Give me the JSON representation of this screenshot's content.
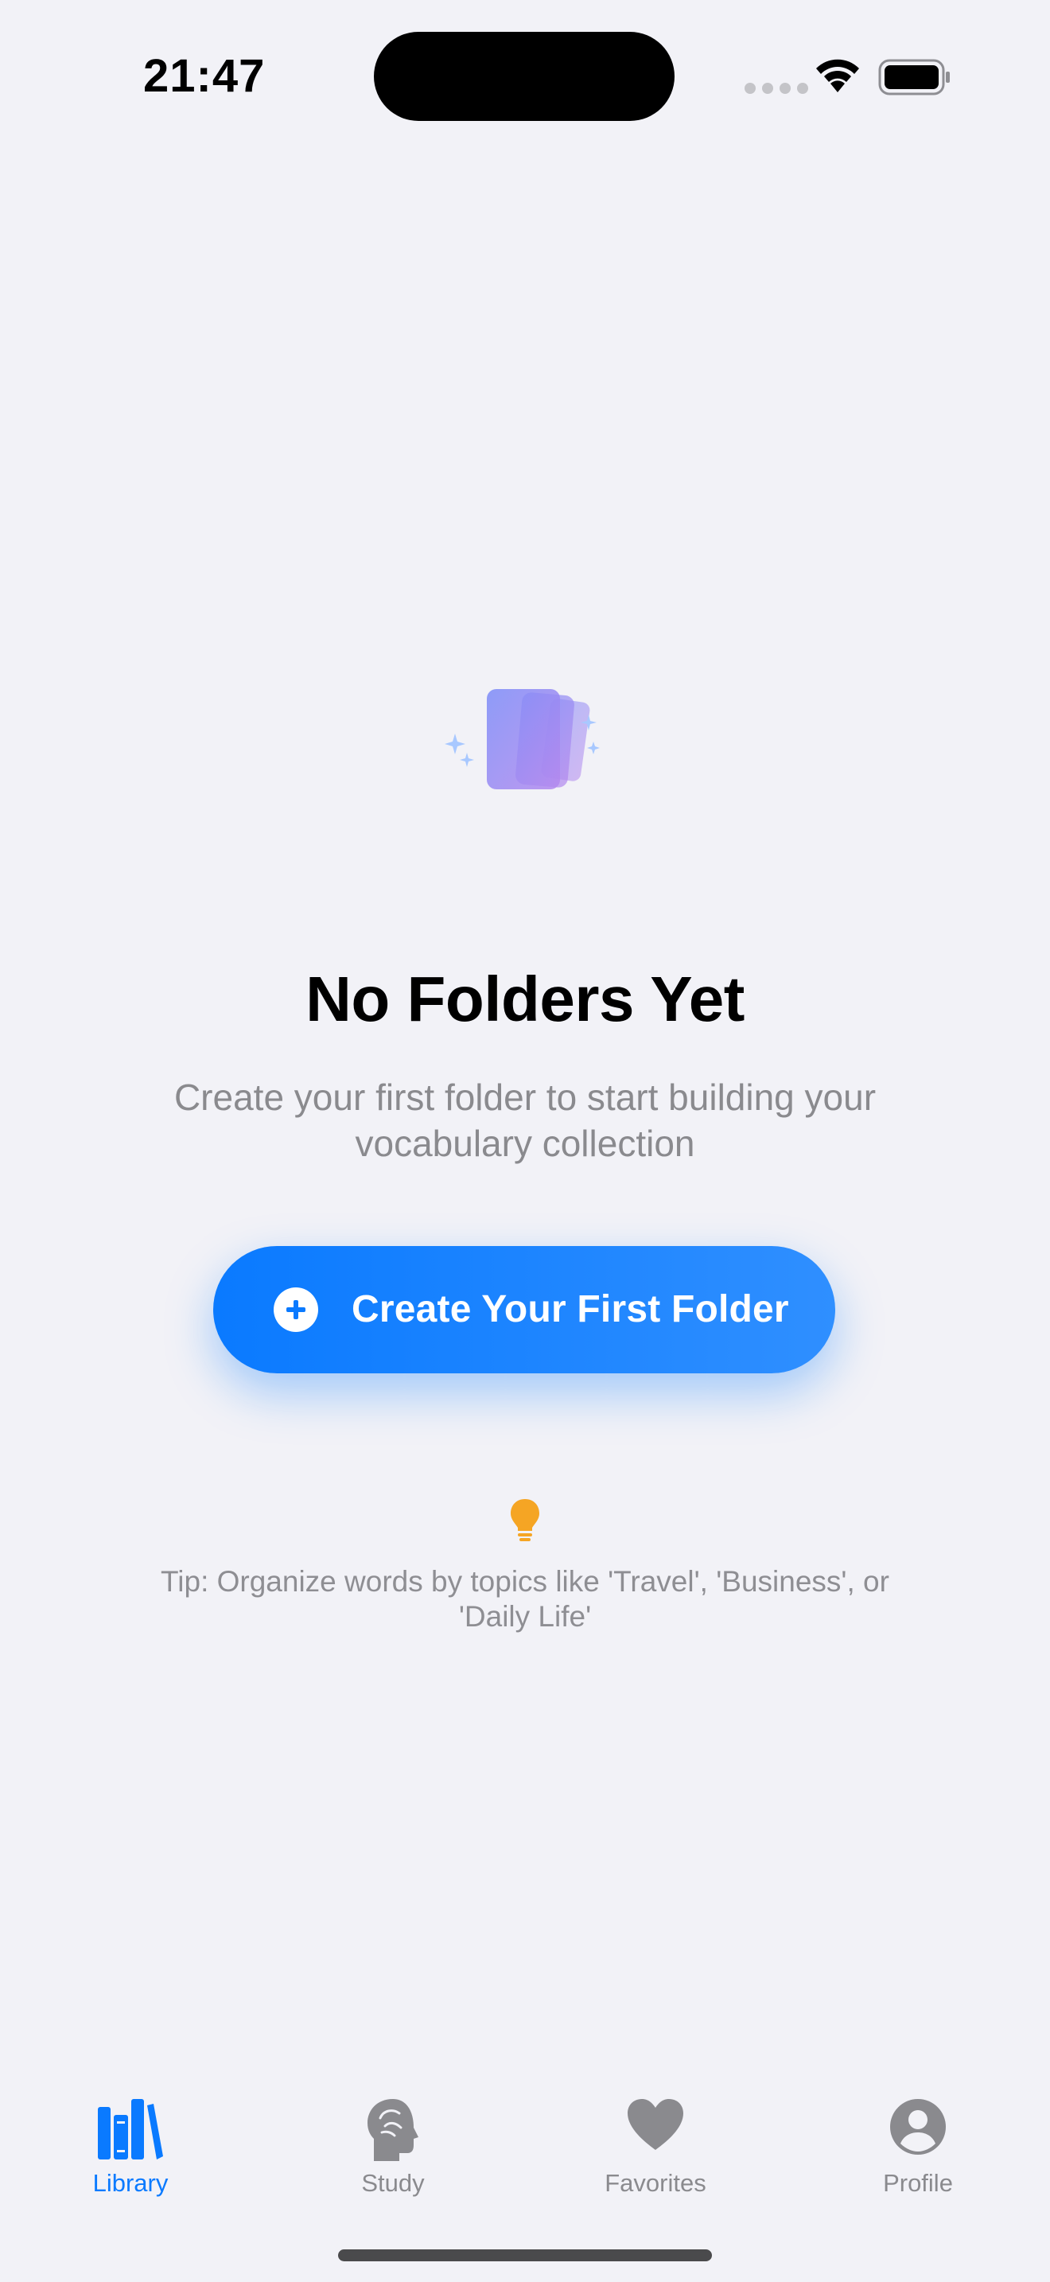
{
  "status_bar": {
    "time": "21:47",
    "icons": [
      "cellular-signal-icon",
      "wifi-icon",
      "battery-icon"
    ]
  },
  "empty_state": {
    "illustration": "stacked-cards-sparkles-icon",
    "title": "No Folders Yet",
    "subtitle": "Create your first folder to start building your vocabulary collection",
    "cta_label": "Create Your First Folder",
    "cta_icon": "plus-circle-icon",
    "tip_icon": "lightbulb-icon",
    "tip_text": "Tip: Organize words by topics like 'Travel', 'Business', or 'Daily Life'"
  },
  "tab_bar": {
    "items": [
      {
        "label": "Library",
        "icon": "books-icon",
        "active": true
      },
      {
        "label": "Study",
        "icon": "brain-head-icon",
        "active": false
      },
      {
        "label": "Favorites",
        "icon": "heart-icon",
        "active": false
      },
      {
        "label": "Profile",
        "icon": "person-circle-icon",
        "active": false
      }
    ]
  },
  "colors": {
    "accent": "#0A7AFF",
    "background": "#F2F2F7",
    "secondary_text": "#8A8A8E",
    "tip_bulb": "#F5A524",
    "illustration": "#8B7BF5"
  }
}
